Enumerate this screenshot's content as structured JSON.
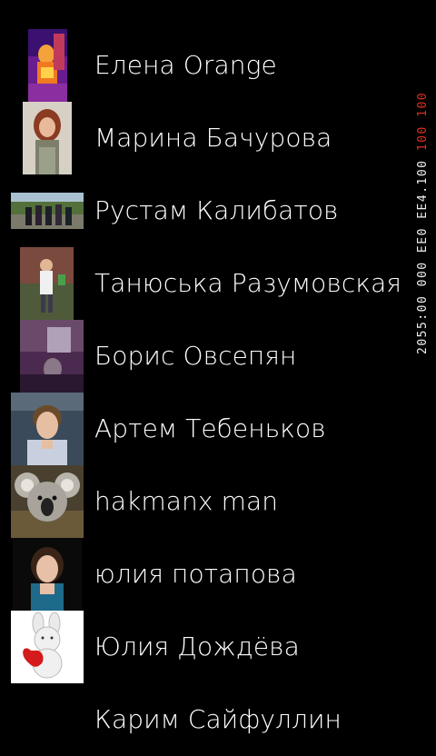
{
  "contacts": [
    {
      "name": "Елена Orange",
      "avatar": "photo-orange-portrait"
    },
    {
      "name": "Марина Бачурова",
      "avatar": "photo-woman-red-hair"
    },
    {
      "name": "Рустам Калибатов",
      "avatar": "photo-group-outdoors"
    },
    {
      "name": "Танюська Разумовская",
      "avatar": "photo-woman-standing"
    },
    {
      "name": "Борис Овсепян",
      "avatar": "photo-dark-purple-room"
    },
    {
      "name": "Артем Тебеньков",
      "avatar": "photo-young-man"
    },
    {
      "name": "hakmanx man",
      "avatar": "photo-koala"
    },
    {
      "name": "юлия потапова",
      "avatar": "photo-woman-smiling"
    },
    {
      "name": "Юлия Дождёва",
      "avatar": "drawing-bunny-heart"
    },
    {
      "name": "Карим Сайфуллин",
      "avatar": "none"
    }
  ],
  "debug_counter": {
    "white": "2055:00 000 EE0 EE4.100",
    "red1": "100",
    "red2": "100"
  },
  "colors": {
    "background": "#000000",
    "text": "#ffffff",
    "counter_red": "#e0301e"
  }
}
